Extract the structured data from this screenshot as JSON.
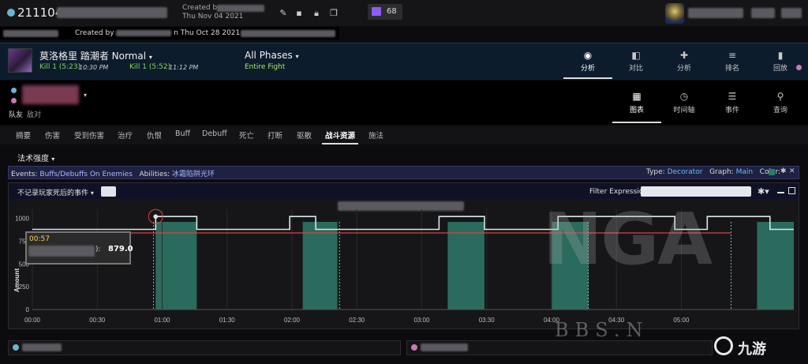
{
  "topbar": {
    "report_id": "211104",
    "created_label": "Created by",
    "created_date": "Thu Nov 04 2021",
    "twitch_count": "68",
    "icons": [
      "pencil-icon",
      "trash-icon",
      "lock-icon",
      "copy-icon",
      "twitch-icon"
    ]
  },
  "created_line": {
    "text": "Created by",
    "date": "n Thu Oct 28 2021"
  },
  "fight": {
    "boss_name": "莫洛格里 踏潮者 Normal",
    "kill1_label": "Kill 1 (5:23)",
    "kill1_time": "10:30 PM",
    "kill2_label": "Kill 1 (5:52)",
    "kill2_time": "11:12 PM",
    "phases_label": "All Phases",
    "phase_value": "Entire Fight"
  },
  "nav_tabs": [
    {
      "label": "分析",
      "icon": "eye-icon"
    },
    {
      "label": "对比",
      "icon": "compare-icon"
    },
    {
      "label": "分析",
      "icon": "puzzle-icon"
    },
    {
      "label": "排名",
      "icon": "rankings-icon"
    },
    {
      "label": "回放",
      "icon": "replay-icon"
    }
  ],
  "friendly": {
    "friend_label": "队友",
    "enemy_label": "敌对"
  },
  "view_tabs": [
    {
      "label": "图表",
      "icon": "grid-icon"
    },
    {
      "label": "时间轴",
      "icon": "clock-icon"
    },
    {
      "label": "事件",
      "icon": "list-icon"
    },
    {
      "label": "查询",
      "icon": "pin-icon"
    }
  ],
  "categories": [
    "摘要",
    "伤害",
    "受到伤害",
    "治疗",
    "仇恨",
    "Buff",
    "Debuff",
    "死亡",
    "打断",
    "驱散",
    "战斗资源",
    "施法"
  ],
  "active_category": "战斗资源",
  "spell_dropdown": "法术强度",
  "events_bar": {
    "events_label": "Events:",
    "events_value": "Buffs/Debuffs On Enemies",
    "abilities_label": "Abilities:",
    "abilities_value": "冰霜陷阱光环",
    "type_label": "Type:",
    "type_value": "Decorator",
    "graph_label": "Graph:",
    "graph_value": "Main",
    "color_label": "Color:",
    "color_value": "#2e7a6a"
  },
  "graph_toolbar": {
    "deaths_dropdown": "不记录玩家死后的事件",
    "filter_label": "Filter Expression:",
    "filter_value": ""
  },
  "tooltip": {
    "time": "00:57",
    "suffix": "):",
    "value": "879.0"
  },
  "watermark": {
    "nga": "NGA",
    "bbs": "BBS.N",
    "jiuyou": "九游"
  },
  "chart_data": {
    "type": "line",
    "ylabel": "Amount",
    "ylim": [
      0,
      1100
    ],
    "y_ticks": [
      "0",
      "250",
      "500",
      "750",
      "1000"
    ],
    "x_ticks": [
      "00:00",
      "00:30",
      "01:00",
      "01:30",
      "02:00",
      "02:30",
      "03:00",
      "03:30",
      "04:00",
      "04:30",
      "05:00"
    ],
    "x_ticks_seconds": [
      0,
      30,
      60,
      90,
      120,
      150,
      180,
      210,
      240,
      270,
      300
    ],
    "xlim": [
      0,
      352
    ],
    "series": [
      {
        "color": "#d8e8ea",
        "points": [
          [
            0,
            879
          ],
          [
            55,
            879
          ],
          [
            55,
            879
          ],
          [
            57,
            879
          ],
          [
            57,
            1020
          ],
          [
            76,
            1020
          ],
          [
            76,
            879
          ],
          [
            119,
            879
          ],
          [
            119,
            1020
          ],
          [
            131,
            1020
          ],
          [
            131,
            879
          ],
          [
            188,
            879
          ],
          [
            188,
            1020
          ],
          [
            209,
            1020
          ],
          [
            209,
            879
          ],
          [
            243,
            879
          ],
          [
            243,
            1020
          ],
          [
            297,
            1020
          ],
          [
            297,
            879
          ],
          [
            312,
            879
          ],
          [
            312,
            1020
          ],
          [
            341,
            1020
          ],
          [
            341,
            879
          ],
          [
            352,
            879
          ]
        ]
      },
      {
        "color": "#e04040",
        "points": [
          [
            0,
            840
          ],
          [
            323,
            840
          ]
        ]
      }
    ],
    "bands": [
      [
        57,
        76
      ],
      [
        125,
        141
      ],
      [
        192,
        209
      ],
      [
        240,
        257
      ],
      [
        335,
        352
      ]
    ],
    "band_color": "#2e7a6a",
    "markers": [
      [
        57,
        1020
      ]
    ],
    "event_lines": [
      56,
      142,
      257,
      323
    ]
  }
}
